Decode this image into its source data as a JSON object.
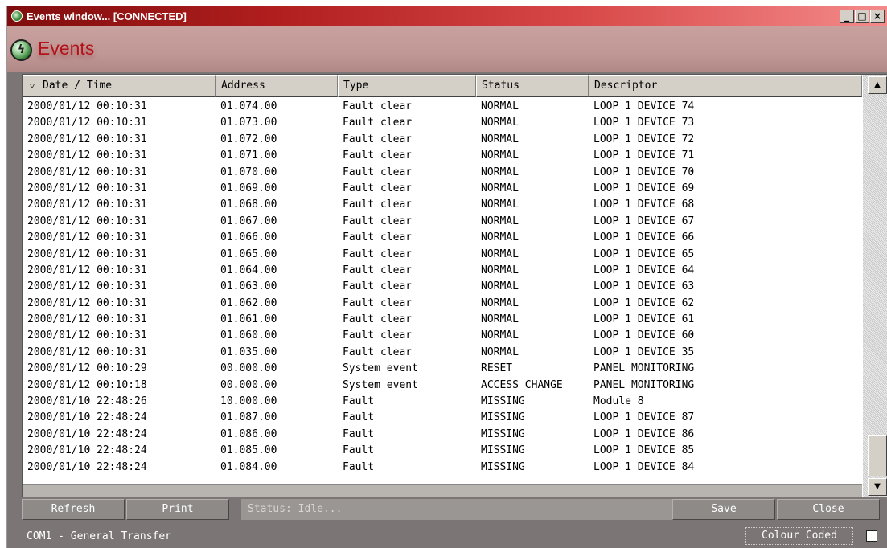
{
  "window": {
    "title": "Events window... [CONNECTED]",
    "controls": [
      "_",
      "□",
      "×"
    ]
  },
  "header": {
    "title": "Events",
    "logo_icon": "lightning-globe-icon"
  },
  "table": {
    "sort_indicator": "▽",
    "columns": [
      "Date / Time",
      "Address",
      "Type",
      "Status",
      "Descriptor"
    ],
    "rows": [
      [
        "2000/01/12 00:10:31",
        "01.074.00",
        "Fault clear",
        "NORMAL",
        "LOOP 1 DEVICE 74"
      ],
      [
        "2000/01/12 00:10:31",
        "01.073.00",
        "Fault clear",
        "NORMAL",
        "LOOP 1 DEVICE 73"
      ],
      [
        "2000/01/12 00:10:31",
        "01.072.00",
        "Fault clear",
        "NORMAL",
        "LOOP 1 DEVICE 72"
      ],
      [
        "2000/01/12 00:10:31",
        "01.071.00",
        "Fault clear",
        "NORMAL",
        "LOOP 1 DEVICE 71"
      ],
      [
        "2000/01/12 00:10:31",
        "01.070.00",
        "Fault clear",
        "NORMAL",
        "LOOP 1 DEVICE 70"
      ],
      [
        "2000/01/12 00:10:31",
        "01.069.00",
        "Fault clear",
        "NORMAL",
        "LOOP 1 DEVICE 69"
      ],
      [
        "2000/01/12 00:10:31",
        "01.068.00",
        "Fault clear",
        "NORMAL",
        "LOOP 1 DEVICE 68"
      ],
      [
        "2000/01/12 00:10:31",
        "01.067.00",
        "Fault clear",
        "NORMAL",
        "LOOP 1 DEVICE 67"
      ],
      [
        "2000/01/12 00:10:31",
        "01.066.00",
        "Fault clear",
        "NORMAL",
        "LOOP 1 DEVICE 66"
      ],
      [
        "2000/01/12 00:10:31",
        "01.065.00",
        "Fault clear",
        "NORMAL",
        "LOOP 1 DEVICE 65"
      ],
      [
        "2000/01/12 00:10:31",
        "01.064.00",
        "Fault clear",
        "NORMAL",
        "LOOP 1 DEVICE 64"
      ],
      [
        "2000/01/12 00:10:31",
        "01.063.00",
        "Fault clear",
        "NORMAL",
        "LOOP 1 DEVICE 63"
      ],
      [
        "2000/01/12 00:10:31",
        "01.062.00",
        "Fault clear",
        "NORMAL",
        "LOOP 1 DEVICE 62"
      ],
      [
        "2000/01/12 00:10:31",
        "01.061.00",
        "Fault clear",
        "NORMAL",
        "LOOP 1 DEVICE 61"
      ],
      [
        "2000/01/12 00:10:31",
        "01.060.00",
        "Fault clear",
        "NORMAL",
        "LOOP 1 DEVICE 60"
      ],
      [
        "2000/01/12 00:10:31",
        "01.035.00",
        "Fault clear",
        "NORMAL",
        "LOOP 1 DEVICE 35"
      ],
      [
        "2000/01/12 00:10:29",
        "00.000.00",
        "System event",
        "RESET",
        "PANEL MONITORING"
      ],
      [
        "2000/01/12 00:10:18",
        "00.000.00",
        "System event",
        "ACCESS CHANGE",
        "PANEL MONITORING"
      ],
      [
        "2000/01/10 22:48:26",
        "10.000.00",
        "Fault",
        "MISSING",
        "Module 8"
      ],
      [
        "2000/01/10 22:48:24",
        "01.087.00",
        "Fault",
        "MISSING",
        "LOOP 1 DEVICE 87"
      ],
      [
        "2000/01/10 22:48:24",
        "01.086.00",
        "Fault",
        "MISSING",
        "LOOP 1 DEVICE 86"
      ],
      [
        "2000/01/10 22:48:24",
        "01.085.00",
        "Fault",
        "MISSING",
        "LOOP 1 DEVICE 85"
      ],
      [
        "2000/01/10 22:48:24",
        "01.084.00",
        "Fault",
        "MISSING",
        "LOOP 1 DEVICE 84"
      ]
    ]
  },
  "scrollbar": {
    "up_arrow": "▲",
    "down_arrow": "▼"
  },
  "buttons": {
    "refresh": "Refresh",
    "print": "Print",
    "save": "Save",
    "close": "Close"
  },
  "status": {
    "text": "Status: Idle..."
  },
  "footer": {
    "connection": "COM1 - General Transfer",
    "colour_coded_label": "Colour Coded",
    "colour_coded_checked": false
  },
  "colors": {
    "title_gradient_start": "#7f0d0d",
    "title_gradient_end": "#f48a8a",
    "header_bg": "#c09896",
    "header_title": "#b4121a",
    "window_bg": "#7b7575",
    "button_bg": "#8e8a88"
  }
}
